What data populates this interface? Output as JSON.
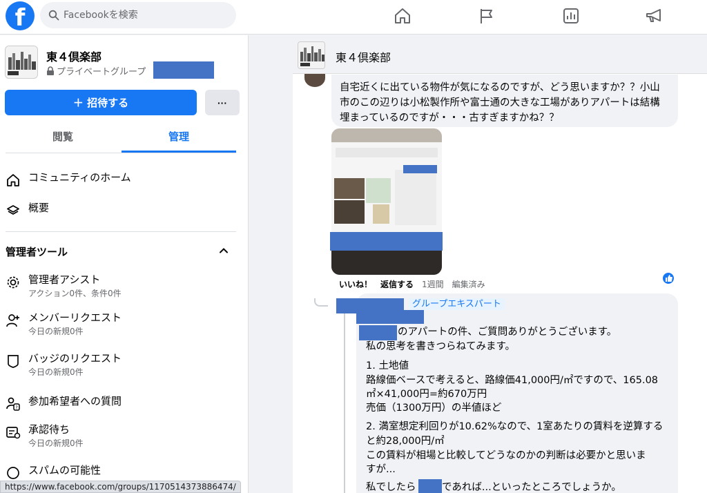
{
  "topbar": {
    "search_placeholder": "Facebookを検索",
    "nav_icons": [
      "home-icon",
      "flag-icon",
      "chart-icon",
      "megaphone-icon"
    ]
  },
  "sidebar": {
    "group_name": "東４倶楽部",
    "privacy": "プライベートグループ",
    "invite_label": "＋ 招待する",
    "more_label": "···",
    "tabs": [
      "閲覧",
      "管理"
    ],
    "nav": [
      {
        "label": "コミュニティのホーム",
        "icon": "home-icon"
      },
      {
        "label": "概要",
        "icon": "layers-icon"
      }
    ],
    "admin_tools_title": "管理者ツール",
    "admin_items": [
      {
        "label": "管理者アシスト",
        "sub": "アクション0件、条件0件",
        "icon": "gear-icon"
      },
      {
        "label": "メンバーリクエスト",
        "sub": "今日の新規0件",
        "icon": "add-person-icon"
      },
      {
        "label": "バッジのリクエスト",
        "sub": "今日の新規0件",
        "icon": "badge-icon"
      },
      {
        "label": "参加希望者への質問",
        "sub": "",
        "icon": "question-icon"
      },
      {
        "label": "承認待ち",
        "sub": "今日の新規0件",
        "icon": "pending-icon"
      },
      {
        "label": "スパムの可能性",
        "sub": "",
        "icon": "spam-icon"
      }
    ],
    "status_url": "https://www.facebook.com/groups/1170514373886474/"
  },
  "main": {
    "header_title": "東４倶楽部",
    "post_text": "自宅近くに出ている物件が気になるのですが、どう思いますか？？小山市のこの辺りは小松製作所や富士通の大きな工場がありアパートは結構埋まっているのですが・・・古すぎますかね？？",
    "actions": {
      "like": "いいね！",
      "reply": "返信する",
      "time": "1週間",
      "edited": "編集済み"
    },
    "reply": {
      "badge": "グループエキスパート",
      "lines": [
        "のアパートの件、ご質問ありがとうございます。",
        "私の思考を書きつらねてみます。",
        "1. 土地値",
        "路線価ベースで考えると、路線価41,000円/㎡ですので、165.08",
        "㎡×41,000円=約670万円",
        "売価（1300万円）の半値ほど",
        "2. 満室想定利回りが10.62%なので、1室あたりの賃料を逆算する",
        "と約28,000円/㎡",
        "この賃料が相場と比較してどうなのかの判断は必要かと思いま",
        "すが...",
        "私でしたら",
        "であれば...といったところでしょうか。"
      ]
    }
  }
}
